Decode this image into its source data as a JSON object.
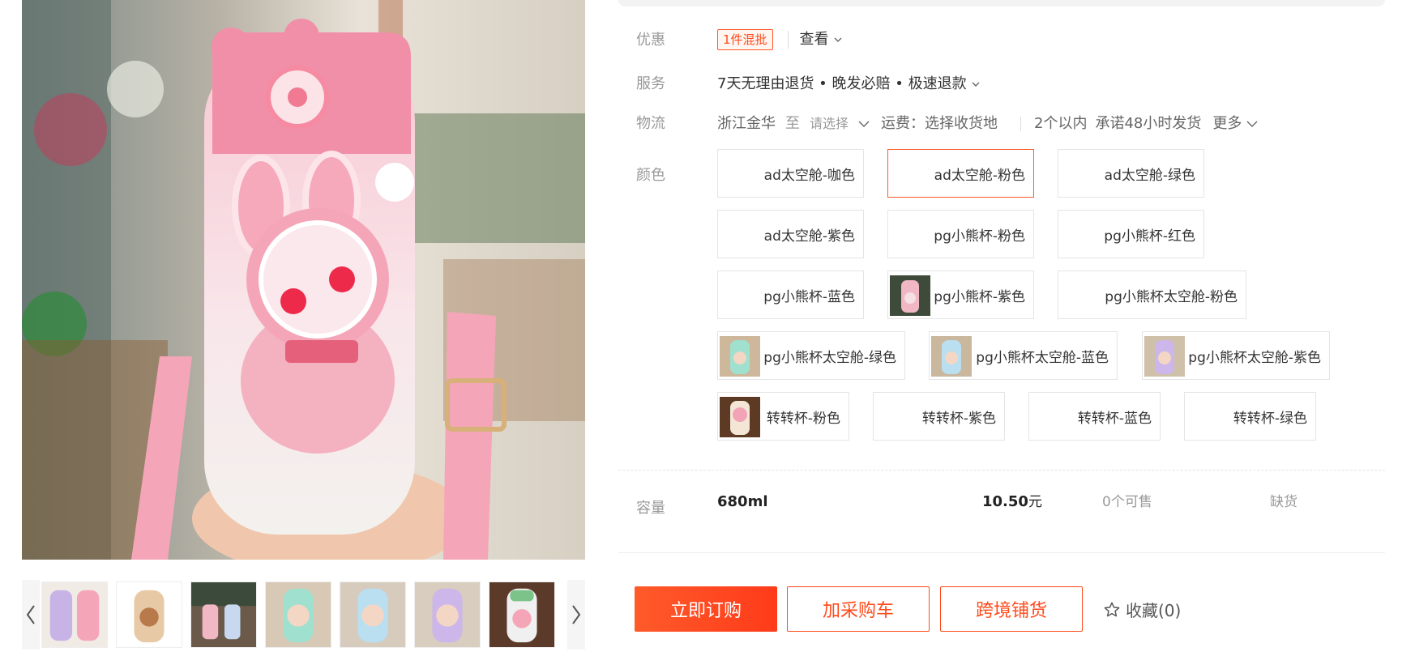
{
  "gallery": {
    "thumbnails": [
      "thumb-1",
      "thumb-2",
      "thumb-3",
      "thumb-4",
      "thumb-5",
      "thumb-6",
      "thumb-7"
    ],
    "prev_icon": "chevron-left-icon",
    "next_icon": "chevron-right-icon"
  },
  "promo": {
    "label": "优惠",
    "tag": "1件混批",
    "view": "查看"
  },
  "service": {
    "label": "服务",
    "text": "7天无理由退货 • 晚发必赔 • 极速退款"
  },
  "logistics": {
    "label": "物流",
    "origin": "浙江金华",
    "to": "至",
    "select": "请选择",
    "freight": "运费：选择收货地",
    "qty": "2个以内",
    "promise": "承诺48小时发货",
    "more": "更多"
  },
  "color": {
    "label": "颜色",
    "options": [
      "ad太空舱-咖色",
      "ad太空舱-粉色",
      "ad太空舱-绿色",
      "ad太空舱-紫色",
      "pg小熊杯-粉色",
      "pg小熊杯-红色",
      "pg小熊杯-蓝色",
      "pg小熊杯-紫色",
      "pg小熊杯太空舱-粉色",
      "pg小熊杯太空舱-绿色",
      "pg小熊杯太空舱-蓝色",
      "pg小熊杯太空舱-紫色",
      "转转杯-粉色",
      "转转杯-紫色",
      "转转杯-蓝色",
      "转转杯-绿色"
    ],
    "selected": "ad太空舱-粉色"
  },
  "capacity": {
    "label": "容量",
    "size": "680ml",
    "price": "10.50",
    "currency": "元",
    "stock": "0个可售",
    "status": "缺货"
  },
  "actions": {
    "buy": "立即订购",
    "cart": "加采购车",
    "cross": "跨境铺货",
    "favorite": "收藏(0)",
    "favorite_icon": "star-outline-icon"
  },
  "colors": {
    "accent": "#ff4a1a",
    "label_grey": "#999999",
    "text": "#333333"
  }
}
